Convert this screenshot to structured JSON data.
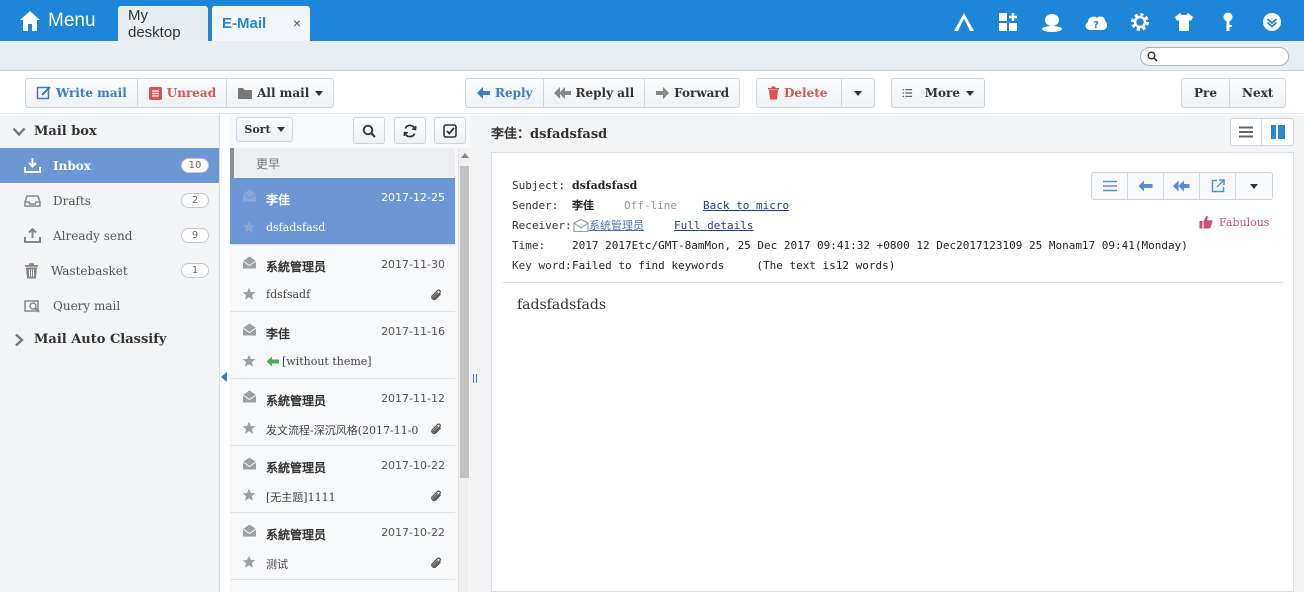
{
  "topbar": {
    "menu_label": "Menu",
    "tabs": [
      {
        "label": "My desktop"
      },
      {
        "label": "E-Mail",
        "close": "×"
      }
    ],
    "icons": [
      "apps-icon",
      "widgets-icon",
      "user-status-icon",
      "cloud-icon",
      "gear-icon",
      "shirt-icon",
      "key-icon",
      "chevron-down-icon"
    ]
  },
  "search": {
    "placeholder": "",
    "value": ""
  },
  "toolbar": {
    "write_mail": "Write mail",
    "unread": "Unread",
    "all_mail": "All mail",
    "reply": "Reply",
    "reply_all": "Reply all",
    "forward": "Forward",
    "delete": "Delete",
    "more": "More",
    "pre": "Pre",
    "next": "Next"
  },
  "sidebar": {
    "mailbox_label": "Mail box",
    "items": [
      {
        "label": "Inbox",
        "count": "10",
        "active": true
      },
      {
        "label": "Drafts",
        "count": "2"
      },
      {
        "label": "Already send",
        "count": "9"
      },
      {
        "label": "Wastebasket",
        "count": "1"
      },
      {
        "label": "Query mail",
        "count": ""
      }
    ],
    "auto_classify_label": "Mail Auto Classify"
  },
  "mail_list": {
    "sort_label": "Sort",
    "group_label": "更早",
    "items": [
      {
        "from": "李佳",
        "date": "2017-12-25",
        "subject": "dsfadsfasd",
        "selected": true,
        "attachment": false,
        "replied": false
      },
      {
        "from": "系統管理员",
        "date": "2017-11-30",
        "subject": "fdsfsadf",
        "selected": false,
        "attachment": true,
        "replied": false
      },
      {
        "from": "李佳",
        "date": "2017-11-16",
        "subject": "[without theme]",
        "selected": false,
        "attachment": false,
        "replied": true
      },
      {
        "from": "系統管理员",
        "date": "2017-11-12",
        "subject": "发文流程-深沉风格(2017-11-0",
        "selected": false,
        "attachment": true,
        "replied": false
      },
      {
        "from": "系統管理员",
        "date": "2017-10-22",
        "subject": "[无主题]1111",
        "selected": false,
        "attachment": true,
        "replied": false
      },
      {
        "from": "系統管理员",
        "date": "2017-10-22",
        "subject": "测试",
        "selected": false,
        "attachment": true,
        "replied": false
      }
    ]
  },
  "reader": {
    "title": "李佳：dsfadsfasd",
    "subject_label": "Subject:",
    "subject": "dsfadsfasd",
    "sender_label": "Sender:",
    "sender": "李佳",
    "sender_status": "Off-line",
    "back_link": "Back to micro",
    "receiver_label": "Receiver:",
    "receiver": "系统管理员",
    "full_details": "Full details",
    "time_label": "Time:",
    "time": "2017 2017Etc/GMT-8amMon, 25 Dec 2017 09:41:32 +0800 12 Dec2017123109 25 Monam17 09:41(Monday)",
    "keyword_label": "Key word:",
    "keyword": "Failed to find keywords",
    "word_count": "(The text is12 words)",
    "fabulous": "Fabulous",
    "body": "fadsfadsfads"
  },
  "colors": {
    "header": "#1e86d8",
    "selected": "#6c96d4",
    "link": "#1a3e9e",
    "danger": "#d9534f",
    "fabulous": "#c9537a"
  }
}
